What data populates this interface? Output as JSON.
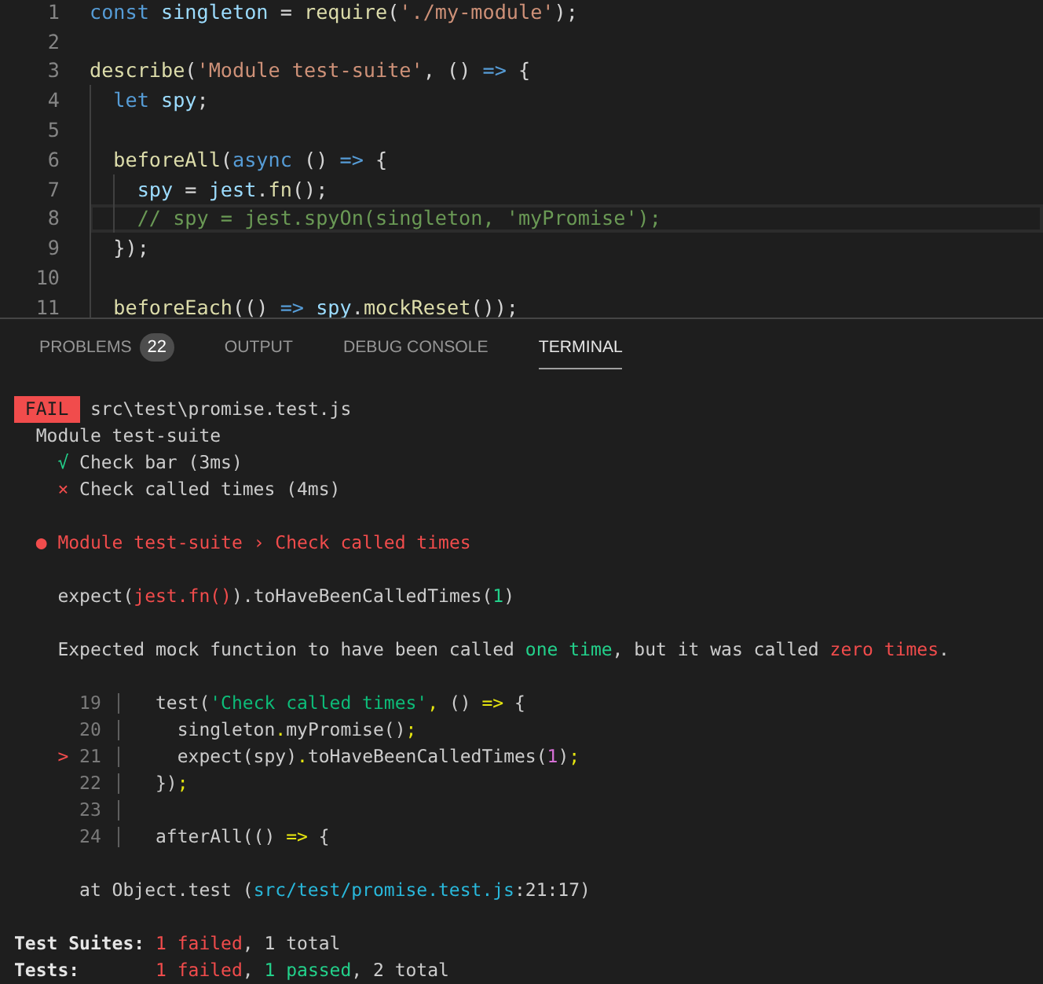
{
  "editor": {
    "lines": [
      {
        "number": "1",
        "active": false,
        "tokens": [
          {
            "text": "const ",
            "kind": "keyword"
          },
          {
            "text": "singleton",
            "kind": "variable"
          },
          {
            "text": " = ",
            "kind": "plain"
          },
          {
            "text": "require",
            "kind": "function"
          },
          {
            "text": "(",
            "kind": "plain"
          },
          {
            "text": "'./my-module'",
            "kind": "string"
          },
          {
            "text": ");",
            "kind": "plain"
          }
        ]
      },
      {
        "number": "2",
        "active": false
      },
      {
        "number": "3",
        "active": false,
        "tokens": [
          {
            "text": "describe",
            "kind": "function"
          },
          {
            "text": "(",
            "kind": "plain"
          },
          {
            "text": "'Module test-suite'",
            "kind": "string"
          },
          {
            "text": ", () ",
            "kind": "plain"
          },
          {
            "text": "=>",
            "kind": "keyword"
          },
          {
            "text": " {",
            "kind": "plain"
          }
        ]
      },
      {
        "number": "4",
        "active": false,
        "tokens": [
          {
            "text": "  let ",
            "kind": "keyword"
          },
          {
            "text": "spy",
            "kind": "variable"
          },
          {
            "text": ";",
            "kind": "plain"
          }
        ]
      },
      {
        "number": "5",
        "active": false
      },
      {
        "number": "6",
        "active": false,
        "tokens": [
          {
            "text": "  beforeAll",
            "kind": "function"
          },
          {
            "text": "(",
            "kind": "plain"
          },
          {
            "text": "async",
            "kind": "keyword"
          },
          {
            "text": " () ",
            "kind": "plain"
          },
          {
            "text": "=>",
            "kind": "keyword"
          },
          {
            "text": " {",
            "kind": "plain"
          }
        ]
      },
      {
        "number": "7",
        "active": false,
        "tokens": [
          {
            "text": "    spy",
            "kind": "variable"
          },
          {
            "text": " = ",
            "kind": "plain"
          },
          {
            "text": "jest",
            "kind": "variable"
          },
          {
            "text": ".",
            "kind": "plain"
          },
          {
            "text": "fn",
            "kind": "function"
          },
          {
            "text": "();",
            "kind": "plain"
          }
        ]
      },
      {
        "number": "8",
        "active": true,
        "tokens": [
          {
            "text": "    // spy = jest.spyOn(singleton, 'myPromise');",
            "kind": "comment"
          }
        ]
      },
      {
        "number": "9",
        "active": false,
        "tokens": [
          {
            "text": "  });",
            "kind": "plain"
          }
        ]
      },
      {
        "number": "10",
        "active": false
      },
      {
        "number": "11",
        "active": false,
        "tokens": [
          {
            "text": "  beforeEach",
            "kind": "function"
          },
          {
            "text": "(() ",
            "kind": "plain"
          },
          {
            "text": "=> ",
            "kind": "keyword"
          },
          {
            "text": "spy",
            "kind": "variable"
          },
          {
            "text": ".",
            "kind": "plain"
          },
          {
            "text": "mockReset",
            "kind": "function"
          },
          {
            "text": "());",
            "kind": "plain"
          }
        ]
      }
    ]
  },
  "panel": {
    "tabs": [
      {
        "label": "PROBLEMS",
        "badge": "22",
        "selected": false
      },
      {
        "label": "OUTPUT",
        "selected": false
      },
      {
        "label": "DEBUG CONSOLE",
        "selected": false
      },
      {
        "label": "TERMINAL",
        "selected": true
      }
    ]
  },
  "terminal": {
    "header": {
      "failed": true,
      "badge": "FAIL",
      "path": "src\\test\\promise.test.js"
    },
    "suite": "Module test-suite",
    "tests": [
      {
        "mark": "√",
        "name": "Check bar (3ms)",
        "passed": true
      },
      {
        "mark": "×",
        "name": "Check called times (4ms)",
        "passed": false
      }
    ],
    "failure": {
      "title": "● Module test-suite › Check called times",
      "assertion": [
        {
          "text": "expect(",
          "kind": "plain"
        },
        {
          "text": "jest.fn()",
          "kind": "received"
        },
        {
          "text": ").toHaveBeenCalledTimes(",
          "kind": "plain"
        },
        {
          "text": "1",
          "kind": "expected"
        },
        {
          "text": ")",
          "kind": "plain"
        }
      ],
      "message": [
        {
          "text": "Expected mock function to have been called ",
          "kind": "plain"
        },
        {
          "text": "one time",
          "kind": "expected"
        },
        {
          "text": ", but it was called ",
          "kind": "plain"
        },
        {
          "text": "zero times",
          "kind": "received"
        },
        {
          "text": ".",
          "kind": "plain"
        }
      ],
      "snippet": [
        {
          "number": "19",
          "tokens": [
            {
              "text": "  test(",
              "kind": "plain"
            },
            {
              "text": "'Check called times'",
              "kind": "string"
            },
            {
              "text": ",",
              "kind": "punct"
            },
            {
              "text": " () ",
              "kind": "plain"
            },
            {
              "text": "=>",
              "kind": "punct"
            },
            {
              "text": " {",
              "kind": "plain"
            }
          ]
        },
        {
          "number": "20",
          "tokens": [
            {
              "text": "    singleton",
              "kind": "plain"
            },
            {
              "text": ".",
              "kind": "punct"
            },
            {
              "text": "myPromise()",
              "kind": "plain"
            },
            {
              "text": ";",
              "kind": "punct"
            }
          ]
        },
        {
          "number": "21",
          "marker": ">",
          "tokens": [
            {
              "text": "    expect(spy)",
              "kind": "plain"
            },
            {
              "text": ".",
              "kind": "punct"
            },
            {
              "text": "toHaveBeenCalledTimes(",
              "kind": "plain"
            },
            {
              "text": "1",
              "kind": "number"
            },
            {
              "text": ")",
              "kind": "plain"
            },
            {
              "text": ";",
              "kind": "punct"
            }
          ]
        },
        {
          "number": "22",
          "tokens": [
            {
              "text": "  })",
              "kind": "plain"
            },
            {
              "text": ";",
              "kind": "punct"
            }
          ]
        },
        {
          "number": "23"
        },
        {
          "number": "24",
          "tokens": [
            {
              "text": "  afterAll(() ",
              "kind": "plain"
            },
            {
              "text": "=>",
              "kind": "punct"
            },
            {
              "text": " {",
              "kind": "plain"
            }
          ]
        }
      ],
      "frame": {
        "prefix": "at Object.test (",
        "link": "src/test/promise.test.js",
        "suffix": ":21:17)"
      }
    },
    "summary": [
      {
        "label": "Test Suites:",
        "values": [
          {
            "text": "1 failed",
            "kind": "failed"
          },
          {
            "text": ", 1 total",
            "kind": "plain"
          }
        ]
      },
      {
        "label": "Tests:",
        "values": [
          {
            "text": "1 failed",
            "kind": "failed"
          },
          {
            "text": ", ",
            "kind": "plain"
          },
          {
            "text": "1 passed",
            "kind": "passed"
          },
          {
            "text": ", 2 total",
            "kind": "plain"
          }
        ]
      }
    ]
  }
}
